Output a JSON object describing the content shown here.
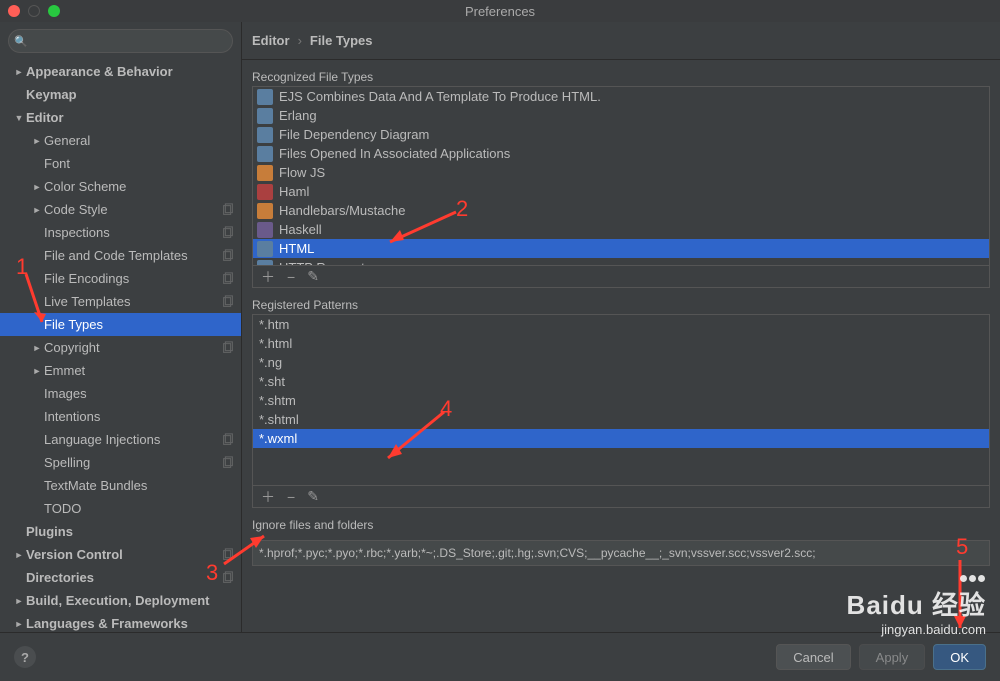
{
  "window": {
    "title": "Preferences"
  },
  "search": {
    "placeholder": ""
  },
  "sidebar": [
    {
      "label": "Appearance & Behavior",
      "level": 0,
      "bold": true,
      "arrow": "►",
      "copy": false
    },
    {
      "label": "Keymap",
      "level": 0,
      "bold": true,
      "arrow": "",
      "copy": false
    },
    {
      "label": "Editor",
      "level": 0,
      "bold": true,
      "arrow": "▼",
      "copy": false
    },
    {
      "label": "General",
      "level": 1,
      "bold": false,
      "arrow": "►",
      "copy": false
    },
    {
      "label": "Font",
      "level": 1,
      "bold": false,
      "arrow": "",
      "copy": false
    },
    {
      "label": "Color Scheme",
      "level": 1,
      "bold": false,
      "arrow": "►",
      "copy": false
    },
    {
      "label": "Code Style",
      "level": 1,
      "bold": false,
      "arrow": "►",
      "copy": true
    },
    {
      "label": "Inspections",
      "level": 1,
      "bold": false,
      "arrow": "",
      "copy": true
    },
    {
      "label": "File and Code Templates",
      "level": 1,
      "bold": false,
      "arrow": "",
      "copy": true
    },
    {
      "label": "File Encodings",
      "level": 1,
      "bold": false,
      "arrow": "",
      "copy": true
    },
    {
      "label": "Live Templates",
      "level": 1,
      "bold": false,
      "arrow": "",
      "copy": true
    },
    {
      "label": "File Types",
      "level": 1,
      "bold": false,
      "arrow": "",
      "copy": false,
      "selected": true
    },
    {
      "label": "Copyright",
      "level": 1,
      "bold": false,
      "arrow": "►",
      "copy": true
    },
    {
      "label": "Emmet",
      "level": 1,
      "bold": false,
      "arrow": "►",
      "copy": false
    },
    {
      "label": "Images",
      "level": 1,
      "bold": false,
      "arrow": "",
      "copy": false
    },
    {
      "label": "Intentions",
      "level": 1,
      "bold": false,
      "arrow": "",
      "copy": false
    },
    {
      "label": "Language Injections",
      "level": 1,
      "bold": false,
      "arrow": "",
      "copy": true
    },
    {
      "label": "Spelling",
      "level": 1,
      "bold": false,
      "arrow": "",
      "copy": true
    },
    {
      "label": "TextMate Bundles",
      "level": 1,
      "bold": false,
      "arrow": "",
      "copy": false
    },
    {
      "label": "TODO",
      "level": 1,
      "bold": false,
      "arrow": "",
      "copy": false
    },
    {
      "label": "Plugins",
      "level": 0,
      "bold": true,
      "arrow": "",
      "copy": false
    },
    {
      "label": "Version Control",
      "level": 0,
      "bold": true,
      "arrow": "►",
      "copy": true
    },
    {
      "label": "Directories",
      "level": 0,
      "bold": true,
      "arrow": "",
      "copy": true
    },
    {
      "label": "Build, Execution, Deployment",
      "level": 0,
      "bold": true,
      "arrow": "►",
      "copy": false
    },
    {
      "label": "Languages & Frameworks",
      "level": 0,
      "bold": true,
      "arrow": "►",
      "copy": false
    }
  ],
  "breadcrumb": {
    "root": "Editor",
    "leaf": "File Types"
  },
  "recognized": {
    "label": "Recognized File Types",
    "items": [
      {
        "label": "EJS Combines Data And A Template To Produce HTML.",
        "icon": "blue"
      },
      {
        "label": "Erlang",
        "icon": "blue"
      },
      {
        "label": "File Dependency Diagram",
        "icon": "blue"
      },
      {
        "label": "Files Opened In Associated Applications",
        "icon": "blue"
      },
      {
        "label": "Flow JS",
        "icon": "orange"
      },
      {
        "label": "Haml",
        "icon": "red"
      },
      {
        "label": "Handlebars/Mustache",
        "icon": "orange"
      },
      {
        "label": "Haskell",
        "icon": "purple"
      },
      {
        "label": "HTML",
        "icon": "blue",
        "selected": true
      },
      {
        "label": "HTTP Requests",
        "icon": "blue"
      }
    ]
  },
  "patterns": {
    "label": "Registered Patterns",
    "items": [
      {
        "label": "*.htm"
      },
      {
        "label": "*.html"
      },
      {
        "label": "*.ng"
      },
      {
        "label": "*.sht"
      },
      {
        "label": "*.shtm"
      },
      {
        "label": "*.shtml"
      },
      {
        "label": "*.wxml",
        "selected": true
      }
    ]
  },
  "ignore": {
    "label": "Ignore files and folders",
    "value": "*.hprof;*.pyc;*.pyo;*.rbc;*.yarb;*~;.DS_Store;.git;.hg;.svn;CVS;__pycache__;_svn;vssver.scc;vssver2.scc;"
  },
  "buttons": {
    "help": "?",
    "cancel": "Cancel",
    "apply": "Apply",
    "ok": "OK"
  },
  "annotations": {
    "n1": "1",
    "n2": "2",
    "n3": "3",
    "n4": "4",
    "n5": "5"
  },
  "watermark": {
    "line1": "Baidu 经验",
    "line2": "jingyan.baidu.com"
  }
}
